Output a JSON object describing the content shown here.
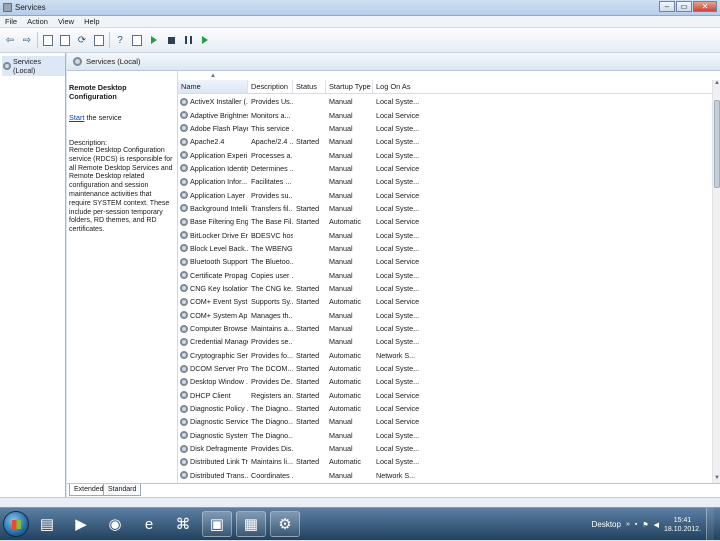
{
  "window": {
    "title": "Services",
    "buttons": [
      "–",
      "▭",
      "✕"
    ]
  },
  "menu": [
    "File",
    "Action",
    "View",
    "Help"
  ],
  "tree": {
    "root": "Services (Local)"
  },
  "pane_header": "Services (Local)",
  "details": {
    "service_name": "Remote Desktop Configuration",
    "start_link": "Start",
    "start_rest": " the service",
    "description_label": "Description:",
    "description": "Remote Desktop Configuration service (RDCS) is responsible for all Remote Desktop Services and Remote Desktop related configuration and session maintenance activities that require SYSTEM context. These include per-session temporary folders, RD themes, and RD certificates."
  },
  "columns": [
    "Name",
    "Description",
    "Status",
    "Startup Type",
    "Log On As"
  ],
  "services": [
    {
      "name": "ActiveX Installer (...",
      "description": "Provides Us...",
      "status": "",
      "startup": "Manual",
      "logon": "Local Syste..."
    },
    {
      "name": "Adaptive Brightness",
      "description": "Monitors a...",
      "status": "",
      "startup": "Manual",
      "logon": "Local Service"
    },
    {
      "name": "Adobe Flash Playe...",
      "description": "This service ...",
      "status": "",
      "startup": "Manual",
      "logon": "Local Syste..."
    },
    {
      "name": "Apache2.4",
      "description": "Apache/2.4 ...",
      "status": "Started",
      "startup": "Manual",
      "logon": "Local Syste..."
    },
    {
      "name": "Application Experi...",
      "description": "Processes a...",
      "status": "",
      "startup": "Manual",
      "logon": "Local Syste..."
    },
    {
      "name": "Application Identity",
      "description": "Determines ...",
      "status": "",
      "startup": "Manual",
      "logon": "Local Service"
    },
    {
      "name": "Application Infor...",
      "description": "Facilitates ...",
      "status": "",
      "startup": "Manual",
      "logon": "Local Syste..."
    },
    {
      "name": "Application Layer ...",
      "description": "Provides su...",
      "status": "",
      "startup": "Manual",
      "logon": "Local Service"
    },
    {
      "name": "Background Intelli...",
      "description": "Transfers fil...",
      "status": "Started",
      "startup": "Manual",
      "logon": "Local Syste..."
    },
    {
      "name": "Base Filtering Engi...",
      "description": "The Base Fil...",
      "status": "Started",
      "startup": "Automatic",
      "logon": "Local Service"
    },
    {
      "name": "BitLocker Drive En...",
      "description": "BDESVC hos...",
      "status": "",
      "startup": "Manual",
      "logon": "Local Syste..."
    },
    {
      "name": "Block Level Back...",
      "description": "The WBENG...",
      "status": "",
      "startup": "Manual",
      "logon": "Local Syste..."
    },
    {
      "name": "Bluetooth Support ...",
      "description": "The Bluetoo...",
      "status": "",
      "startup": "Manual",
      "logon": "Local Service"
    },
    {
      "name": "Certificate Propag...",
      "description": "Copies user ...",
      "status": "",
      "startup": "Manual",
      "logon": "Local Syste..."
    },
    {
      "name": "CNG Key Isolation",
      "description": "The CNG ke...",
      "status": "Started",
      "startup": "Manual",
      "logon": "Local Syste..."
    },
    {
      "name": "COM+ Event Syst...",
      "description": "Supports Sy...",
      "status": "Started",
      "startup": "Automatic",
      "logon": "Local Service"
    },
    {
      "name": "COM+ System Ap...",
      "description": "Manages th...",
      "status": "",
      "startup": "Manual",
      "logon": "Local Syste..."
    },
    {
      "name": "Computer Browser",
      "description": "Maintains a...",
      "status": "Started",
      "startup": "Manual",
      "logon": "Local Syste..."
    },
    {
      "name": "Credential Manager",
      "description": "Provides se...",
      "status": "",
      "startup": "Manual",
      "logon": "Local Syste..."
    },
    {
      "name": "Cryptographic Ser...",
      "description": "Provides fo...",
      "status": "Started",
      "startup": "Automatic",
      "logon": "Network S..."
    },
    {
      "name": "DCOM Server Pro...",
      "description": "The DCOM...",
      "status": "Started",
      "startup": "Automatic",
      "logon": "Local Syste..."
    },
    {
      "name": "Desktop Window ...",
      "description": "Provides De...",
      "status": "Started",
      "startup": "Automatic",
      "logon": "Local Syste..."
    },
    {
      "name": "DHCP Client",
      "description": "Registers an...",
      "status": "Started",
      "startup": "Automatic",
      "logon": "Local Service"
    },
    {
      "name": "Diagnostic Policy ...",
      "description": "The Diagno...",
      "status": "Started",
      "startup": "Automatic",
      "logon": "Local Service"
    },
    {
      "name": "Diagnostic Service...",
      "description": "The Diagno...",
      "status": "Started",
      "startup": "Manual",
      "logon": "Local Service"
    },
    {
      "name": "Diagnostic System ...",
      "description": "The Diagno...",
      "status": "",
      "startup": "Manual",
      "logon": "Local Syste..."
    },
    {
      "name": "Disk Defragmenter",
      "description": "Provides Dis...",
      "status": "",
      "startup": "Manual",
      "logon": "Local Syste..."
    },
    {
      "name": "Distributed Link Tr...",
      "description": "Maintains li...",
      "status": "Started",
      "startup": "Automatic",
      "logon": "Local Syste..."
    },
    {
      "name": "Distributed Trans...",
      "description": "Coordinates ...",
      "status": "",
      "startup": "Manual",
      "logon": "Network S..."
    }
  ],
  "tabs": [
    "Extended",
    "Standard"
  ],
  "taskbar": {
    "apps": [
      "folder",
      "media-player",
      "firefox",
      "internet-explorer",
      "acrobat",
      "powerpoint",
      "outlook",
      "services"
    ],
    "desktop_label": "Desktop",
    "clock_time": "15:41",
    "clock_date": "18.10.2012."
  }
}
